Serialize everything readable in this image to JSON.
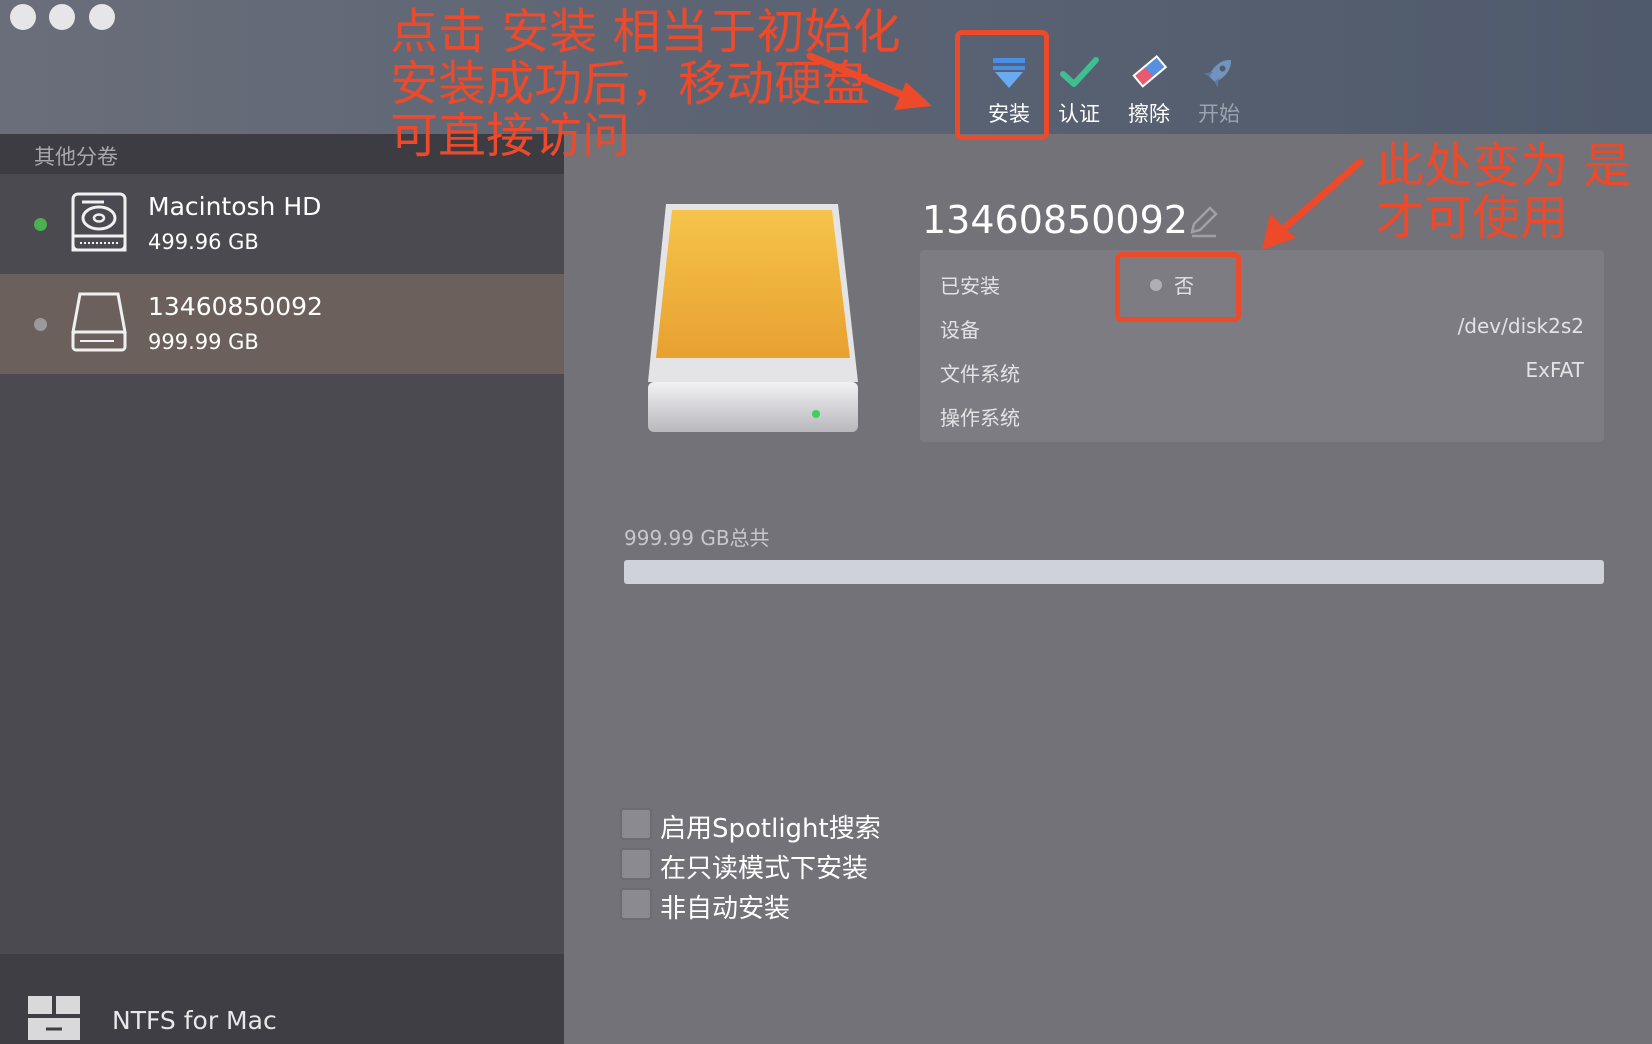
{
  "toolbar": {
    "install": "安装",
    "verify": "认证",
    "erase": "擦除",
    "start": "开始"
  },
  "sidebar": {
    "section_title": "其他分卷",
    "volumes": [
      {
        "name": "Macintosh HD",
        "size": "499.96 GB",
        "status_color": "#4caf50"
      },
      {
        "name": "13460850092",
        "size": "999.99 GB",
        "status_color": "#9a9a9e"
      }
    ],
    "footer_app_name": "NTFS for Mac"
  },
  "main": {
    "volume_title": "13460850092",
    "info": {
      "installed_label": "已安装",
      "installed_value": "否",
      "device_label": "设备",
      "device_value": "/dev/disk2s2",
      "filesystem_label": "文件系统",
      "filesystem_value": "ExFAT",
      "os_label": "操作系统",
      "os_value": ""
    },
    "storage": {
      "total_label": "999.99 GB总共",
      "used_fraction": 0
    },
    "options": [
      {
        "label": "启用Spotlight搜索",
        "checked": false
      },
      {
        "label": "在只读模式下安装",
        "checked": false
      },
      {
        "label": "非自动安装",
        "checked": false
      }
    ]
  },
  "annotations": {
    "left_lines": [
      "点击 安装 相当于初始化",
      "安装成功后，移动硬盘",
      "可直接访问"
    ],
    "right_lines": [
      "此处变为 是",
      "才可使用"
    ],
    "color": "#ec4a2a"
  }
}
